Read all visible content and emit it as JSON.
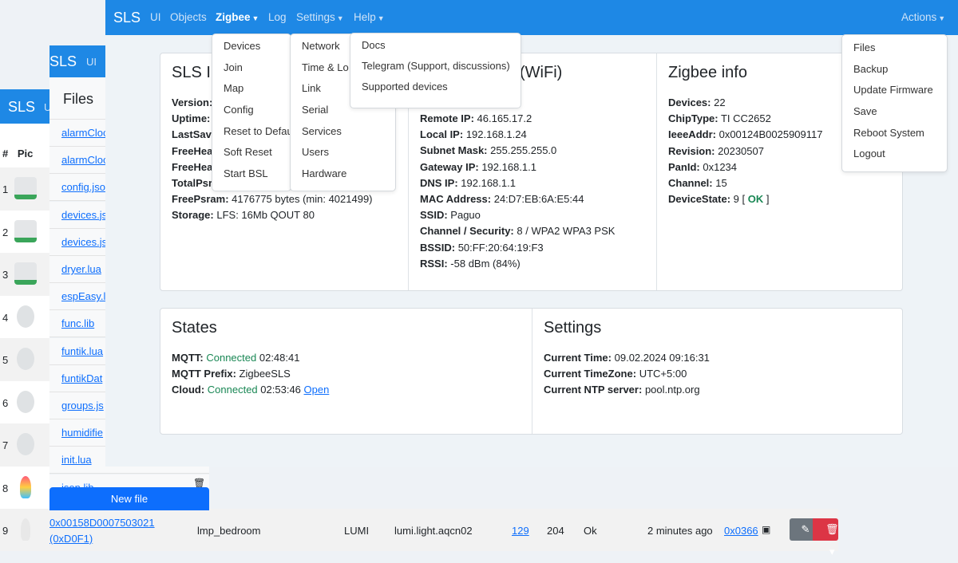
{
  "brand": "SLS",
  "back_table": {
    "nav_brand": "SLS",
    "nav_ui": "U",
    "headers": [
      "#",
      "Pic"
    ],
    "rows": [
      {
        "n": "1",
        "pic": "relay"
      },
      {
        "n": "2",
        "pic": "relay"
      },
      {
        "n": "3",
        "pic": "relay"
      },
      {
        "n": "4",
        "pic": "plug"
      },
      {
        "n": "5",
        "pic": "sensor"
      },
      {
        "n": "6",
        "pic": "plug"
      },
      {
        "n": "7",
        "pic": "sensor"
      },
      {
        "n": "8",
        "pic": "bulb"
      }
    ],
    "row9": {
      "n": "9",
      "ieee": "0x00158D0007503021",
      "nwk": "(0xD0F1)",
      "name": "lmp_bedroom",
      "vendor": "LUMI",
      "model": "lumi.light.aqcn02",
      "lqi": "129",
      "rssi": "204",
      "status": "Ok",
      "last_seen": "2 minutes ago",
      "router": "0x0366"
    }
  },
  "files_panel": {
    "nav_brand": "SLS",
    "nav_ui": "UI",
    "title": "Files",
    "files": [
      "alarmCloc",
      "alarmCloc",
      "config.jso",
      "devices.js",
      "devices.js",
      "dryer.lua",
      "espEasy.l",
      "func.lib",
      "funtik.lua",
      "funtikDat",
      "groups.js",
      "humidifie",
      "init.lua",
      "json.lib"
    ],
    "new_file": "New file"
  },
  "nav": {
    "items": [
      "UI",
      "Objects",
      "Zigbee",
      "Log",
      "Settings",
      "Help"
    ],
    "actions": "Actions"
  },
  "zigbee_menu": [
    "Devices",
    "Join",
    "Map",
    "Config",
    "Reset to Defau",
    "Soft Reset",
    "Start BSL"
  ],
  "settings_menu": [
    "Network",
    "Time & Lo",
    "Link",
    "Serial",
    "Services",
    "Users",
    "Hardware"
  ],
  "help_menu": [
    "Docs",
    "Telegram (Support, discussions)",
    "Supported devices"
  ],
  "actions_menu": [
    "Files",
    "Backup",
    "Update Firmware",
    "Save",
    "Reboot System",
    "Logout"
  ],
  "sls_info": {
    "title": "SLS In",
    "rows": [
      [
        "Version:",
        ""
      ],
      [
        "Uptime:",
        ""
      ],
      [
        "LastSave",
        ""
      ],
      [
        "FreeHea",
        ""
      ],
      [
        "FreeHea",
        ""
      ],
      [
        "TotalPsr",
        ""
      ],
      [
        "FreePsram:",
        "4176775 bytes (min: 4021499)"
      ],
      [
        "Storage:",
        "LFS: 16Mb QOUT 80"
      ]
    ]
  },
  "wifi_info": {
    "title": "(WiFi)",
    "rows": [
      [
        "Remote IP:",
        "46.165.17.2"
      ],
      [
        "Local IP:",
        "192.168.1.24"
      ],
      [
        "Subnet Mask:",
        "255.255.255.0"
      ],
      [
        "Gateway IP:",
        "192.168.1.1"
      ],
      [
        "DNS IP:",
        "192.168.1.1"
      ],
      [
        "MAC Address:",
        "24:D7:EB:6A:E5:44"
      ],
      [
        "SSID:",
        "Paguo"
      ],
      [
        "Channel / Security:",
        "8 / WPA2 WPA3 PSK"
      ],
      [
        "BSSID:",
        "50:FF:20:64:19:F3"
      ],
      [
        "RSSI:",
        "-58 dBm (84%)"
      ]
    ]
  },
  "zigbee_info": {
    "title": "Zigbee info",
    "rows": [
      [
        "Devices:",
        "22"
      ],
      [
        "ChipType:",
        "TI CC2652"
      ],
      [
        "IeeeAddr:",
        "0x00124B0025909117"
      ],
      [
        "Revision:",
        "20230507"
      ],
      [
        "PanId:",
        "0x1234"
      ],
      [
        "Channel:",
        "15"
      ]
    ],
    "state_label": "DeviceState:",
    "state_value": "9 [",
    "state_ok": "OK",
    "state_close": "]"
  },
  "states": {
    "title": "States",
    "mqtt_label": "MQTT:",
    "mqtt_status": "Connected",
    "mqtt_time": "02:48:41",
    "prefix_label": "MQTT Prefix:",
    "prefix": "ZigbeeSLS",
    "cloud_label": "Cloud:",
    "cloud_status": "Connected",
    "cloud_time": "02:53:46",
    "cloud_open": "Open"
  },
  "settings": {
    "title": "Settings",
    "rows": [
      [
        "Current Time:",
        "09.02.2024 09:16:31"
      ],
      [
        "Current TimeZone:",
        "UTC+5:00"
      ],
      [
        "Current NTP server:",
        "pool.ntp.org"
      ]
    ]
  },
  "colors": {
    "navbar": "#1e88e5",
    "primary": "#0d6efd",
    "success": "#198754",
    "danger": "#dc3545"
  }
}
